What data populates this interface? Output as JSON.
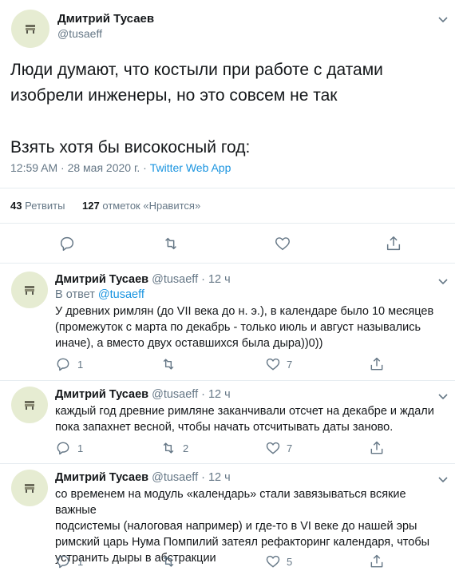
{
  "main_tweet": {
    "author_name": "Дмитрий Тусаев",
    "handle": "@tusaeff",
    "text_line1": "Люди думают, что костыли при работе с датами",
    "text_line2": "изобрели инженеры, но это совсем не так",
    "text_line3": "Взять хотя бы високосный год:",
    "timestamp": "12:59 AM · 28 мая 2020 г. ·",
    "source": "Twitter Web App",
    "retweets_count": "43",
    "retweets_label": "Ретвиты",
    "likes_count": "127",
    "likes_label": "отметок «Нравится»"
  },
  "replies": [
    {
      "author_name": "Дмитрий Тусаев",
      "handle_time": "@tusaeff · 12 ч",
      "reply_to_label": "В ответ",
      "reply_to_handle": "@tusaeff",
      "lines": [
        "У древних римлян (до VII века до н. э.), в календаре было 10 месяцев",
        "(промежуток с марта по декабрь - только июль и август назывались",
        "иначе), а вместо двух оставшихся была дыра))0))"
      ],
      "reply_count": "1",
      "retweet_count": "",
      "like_count": "7"
    },
    {
      "author_name": "Дмитрий Тусаев",
      "handle_time": "@tusaeff · 12 ч",
      "lines": [
        "каждый год древние римляне заканчивали отсчет на декабре и ждали",
        "пока запахнет весной, чтобы начать отсчитывать даты заново."
      ],
      "reply_count": "1",
      "retweet_count": "2",
      "like_count": "7"
    },
    {
      "author_name": "Дмитрий Тусаев",
      "handle_time": "@tusaeff · 12 ч",
      "lines": [
        "со временем на модуль «календарь» стали завязываться всякие важные",
        "подсистемы (налоговая например) и где-то в VI веке до нашей эры",
        "римский царь Нума Помпилий затеял рефакторинг календаря, чтобы",
        "устранить дыры в абстракции"
      ],
      "reply_count": "1",
      "retweet_count": "",
      "like_count": "5"
    }
  ],
  "icons": {
    "reply": "reply-icon",
    "retweet": "retweet-icon",
    "like": "like-icon",
    "share": "share-icon",
    "more": "chevron-down-icon"
  },
  "colors": {
    "link": "#1b95e0",
    "muted": "#657786",
    "text": "#14171a",
    "divider": "#e6ecf0"
  }
}
